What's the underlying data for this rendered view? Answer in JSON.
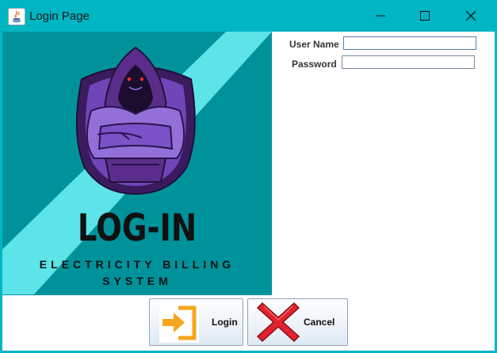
{
  "window": {
    "title": "Login Page"
  },
  "banner": {
    "title": "LOG-IN",
    "subtitle_line1": "ELECTRICITY BILLING",
    "subtitle_line2": "SYSTEM"
  },
  "form": {
    "username_label": "User Name",
    "username_value": "",
    "password_label": "Password",
    "password_value": ""
  },
  "buttons": {
    "login_label": "Login",
    "cancel_label": "Cancel"
  },
  "icons": {
    "app": "java-icon",
    "login": "login-arrow-icon",
    "cancel": "red-x-icon"
  },
  "colors": {
    "titlebar": "#00b5c4",
    "banner_bg": "#00929b",
    "banner_stripe": "#5ce4e8",
    "hood": "#5a2d8a",
    "hood_light": "#9370d8",
    "cancel_red": "#e0232e",
    "login_orange": "#f6a61e"
  }
}
